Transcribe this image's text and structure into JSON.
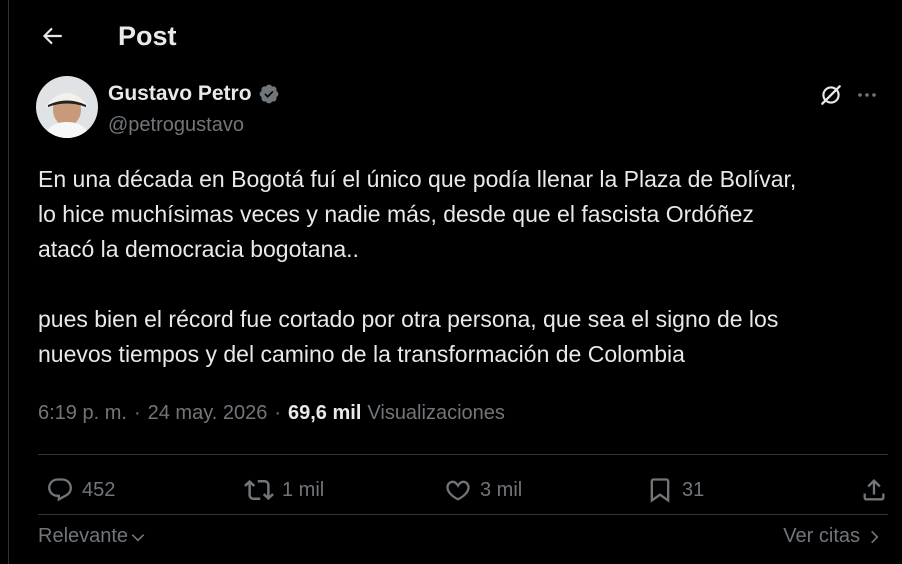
{
  "header": {
    "title": "Post",
    "back_icon": "arrow-left-icon"
  },
  "author": {
    "name": "Gustavo Petro",
    "handle": "@petrogustavo",
    "verified_color": "#1d9bf0"
  },
  "post": {
    "paragraphs": [
      "En una década en Bogotá fuí el único que podía llenar la Plaza de Bolívar,\nlo hice muchísimas veces y nadie más, desde que el fascista Ordóñez\natacó la democracia bogotana..",
      "pues bien el récord fue cortado por otra persona, que sea el signo de los\nnuevos tiempos y del camino de la transformación de Colombia"
    ],
    "time": "6:19 p. m.",
    "separator": "·",
    "date": "24 may. 2026",
    "views_count": "69,6 mil",
    "views_label": "Visualizaciones"
  },
  "actions": {
    "replies": "452",
    "reposts": "1 mil",
    "likes": "3 mil",
    "bookmarks": "31"
  },
  "footer": {
    "sort_label": "Relevante",
    "quotes_label": "Ver citas"
  },
  "colors": {
    "background": "#000000",
    "text": "#e7e9ea",
    "secondary": "#71767b",
    "divider": "#2f3336",
    "accent": "#1d9bf0"
  }
}
